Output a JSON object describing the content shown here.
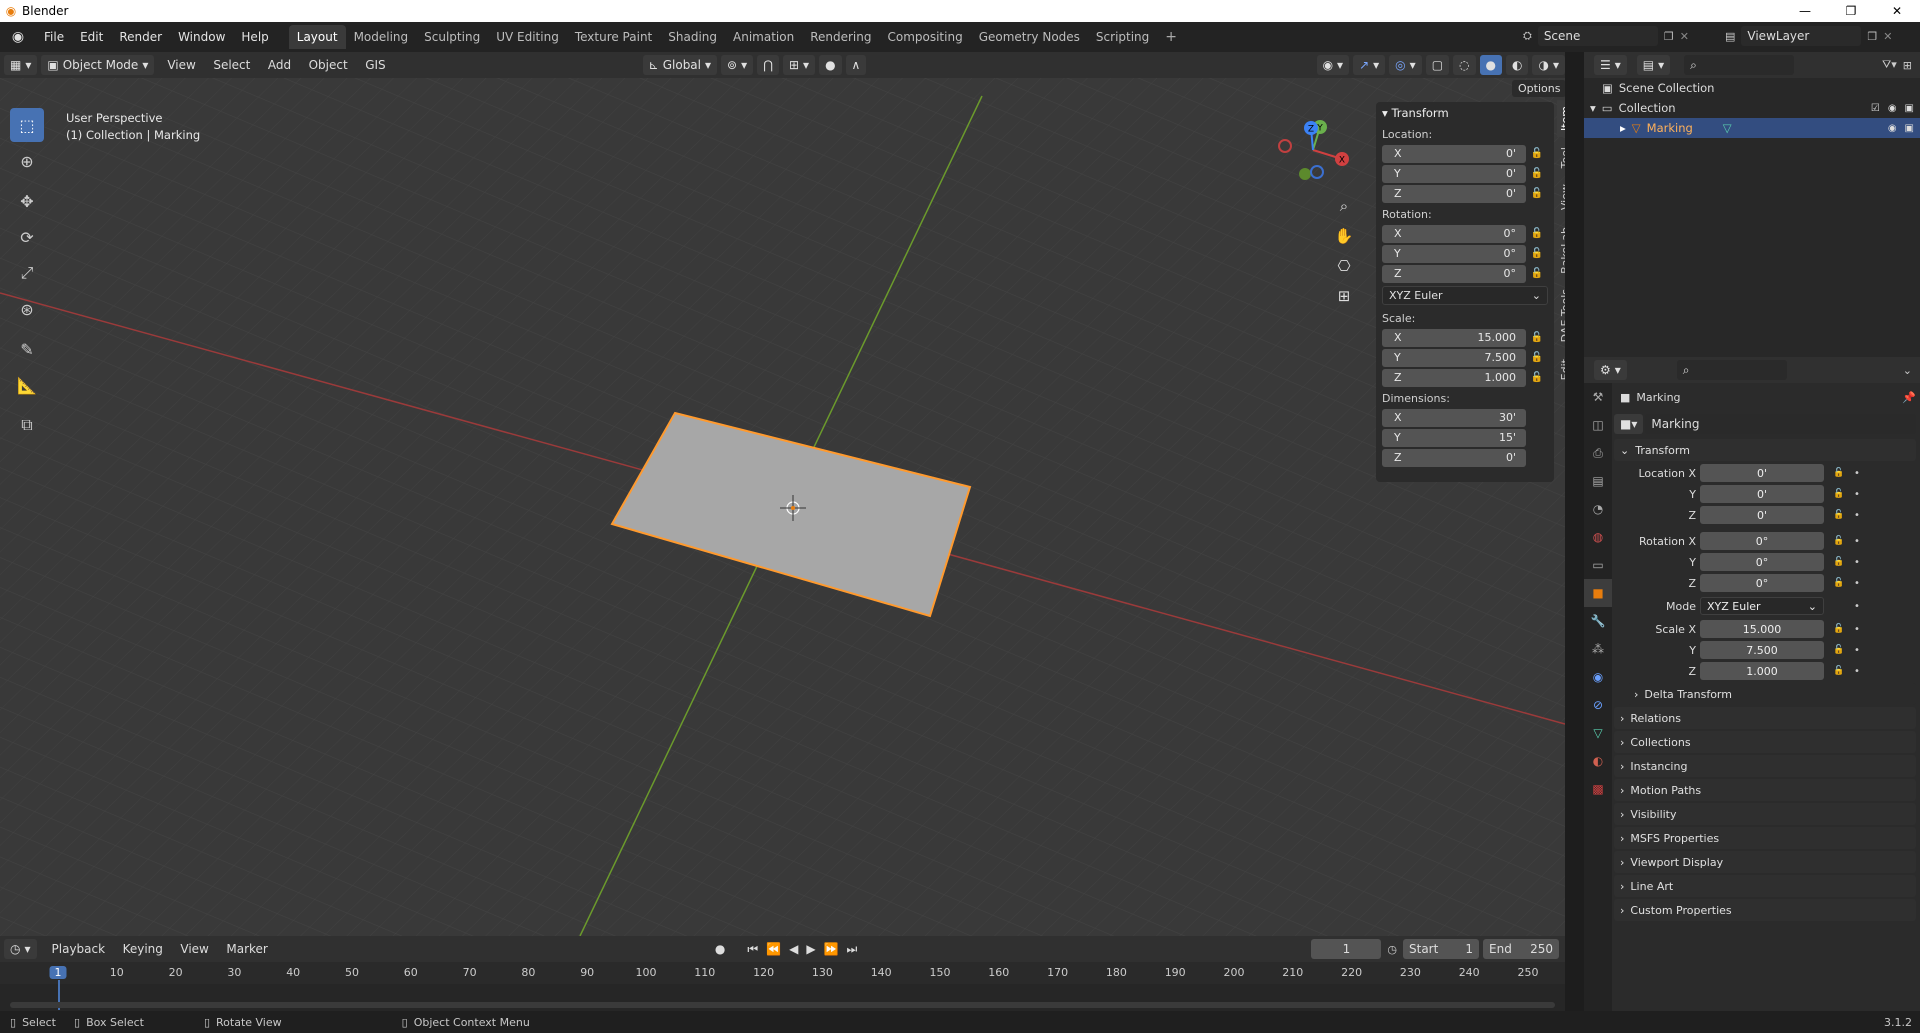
{
  "window": {
    "title": "Blender",
    "controls": [
      "—",
      "❐",
      "✕"
    ]
  },
  "menu": [
    "File",
    "Edit",
    "Render",
    "Window",
    "Help"
  ],
  "workspaces": [
    "Layout",
    "Modeling",
    "Sculpting",
    "UV Editing",
    "Texture Paint",
    "Shading",
    "Animation",
    "Rendering",
    "Compositing",
    "Geometry Nodes",
    "Scripting"
  ],
  "active_workspace": "Layout",
  "scene": "Scene",
  "view_layer": "ViewLayer",
  "viewport": {
    "mode": "Object Mode",
    "menus": [
      "View",
      "Select",
      "Add",
      "Object",
      "GIS"
    ],
    "orientation": "Global",
    "info_line1": "User Perspective",
    "info_line2": "(1) Collection | Marking",
    "options": "Options",
    "gizmo": {
      "x": "X",
      "y": "Y",
      "z": "Z"
    }
  },
  "npanel": {
    "header": "Transform",
    "location_label": "Location:",
    "location": [
      {
        "axis": "X",
        "value": "0'"
      },
      {
        "axis": "Y",
        "value": "0'"
      },
      {
        "axis": "Z",
        "value": "0'"
      }
    ],
    "rotation_label": "Rotation:",
    "rotation": [
      {
        "axis": "X",
        "value": "0°"
      },
      {
        "axis": "Y",
        "value": "0°"
      },
      {
        "axis": "Z",
        "value": "0°"
      }
    ],
    "rotation_mode": "XYZ Euler",
    "scale_label": "Scale:",
    "scale": [
      {
        "axis": "X",
        "value": "15.000"
      },
      {
        "axis": "Y",
        "value": "7.500"
      },
      {
        "axis": "Z",
        "value": "1.000"
      }
    ],
    "dimensions_label": "Dimensions:",
    "dimensions": [
      {
        "axis": "X",
        "value": "30'"
      },
      {
        "axis": "Y",
        "value": "15'"
      },
      {
        "axis": "Z",
        "value": "0'"
      }
    ],
    "tabs": [
      "Item",
      "Tool",
      "View",
      "BakeLab",
      "DAE Tools",
      "Edit"
    ]
  },
  "outliner": {
    "scene_collection": "Scene Collection",
    "collection": "Collection",
    "object": "Marking"
  },
  "properties": {
    "object_name": "Marking",
    "data_name": "Marking",
    "transform_header": "Transform",
    "location": [
      {
        "label": "Location X",
        "value": "0'"
      },
      {
        "label": "Y",
        "value": "0'"
      },
      {
        "label": "Z",
        "value": "0'"
      }
    ],
    "rotation": [
      {
        "label": "Rotation X",
        "value": "0°"
      },
      {
        "label": "Y",
        "value": "0°"
      },
      {
        "label": "Z",
        "value": "0°"
      }
    ],
    "mode_label": "Mode",
    "mode_value": "XYZ Euler",
    "scale": [
      {
        "label": "Scale X",
        "value": "15.000"
      },
      {
        "label": "Y",
        "value": "7.500"
      },
      {
        "label": "Z",
        "value": "1.000"
      }
    ],
    "delta": "Delta Transform",
    "panels": [
      "Relations",
      "Collections",
      "Instancing",
      "Motion Paths",
      "Visibility",
      "MSFS Properties",
      "Viewport Display",
      "Line Art",
      "Custom Properties"
    ]
  },
  "timeline": {
    "menus": [
      "Playback",
      "Keying",
      "View",
      "Marker"
    ],
    "current_frame": "1",
    "start_label": "Start",
    "start": "1",
    "end_label": "End",
    "end": "250",
    "ticks": [
      "1",
      "10",
      "20",
      "30",
      "40",
      "50",
      "60",
      "70",
      "80",
      "90",
      "100",
      "110",
      "120",
      "130",
      "140",
      "150",
      "160",
      "170",
      "180",
      "190",
      "200",
      "210",
      "220",
      "230",
      "240",
      "250"
    ]
  },
  "status": {
    "select": "Select",
    "box_select": "Box Select",
    "rotate_view": "Rotate View",
    "context_menu": "Object Context Menu",
    "version": "3.1.2"
  }
}
